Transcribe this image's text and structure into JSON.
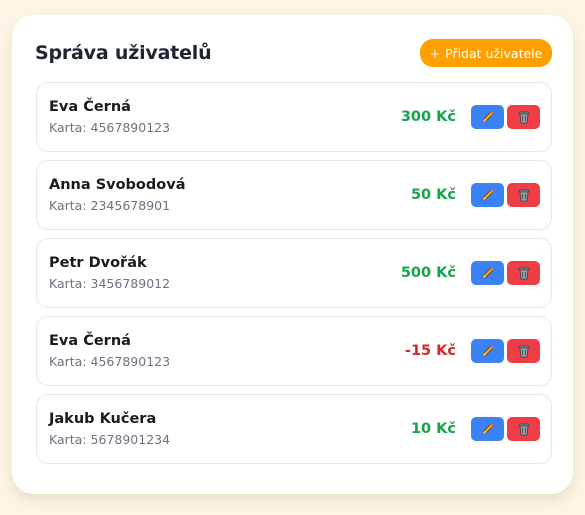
{
  "header": {
    "title": "Správa uživatelů",
    "add_button_icon": "+",
    "add_button_label": "Přidat uživatele"
  },
  "users": [
    {
      "name": "Eva Černá",
      "card": "Karta: 4567890123",
      "balance": "300 Kč",
      "status": "positive"
    },
    {
      "name": "Anna Svobodová",
      "card": "Karta: 2345678901",
      "balance": "50 Kč",
      "status": "positive"
    },
    {
      "name": "Petr Dvořák",
      "card": "Karta: 3456789012",
      "balance": "500 Kč",
      "status": "positive"
    },
    {
      "name": "Eva Černá",
      "card": "Karta: 4567890123",
      "balance": "-15 Kč",
      "status": "negative"
    },
    {
      "name": "Jakub Kučera",
      "card": "Karta: 5678901234",
      "balance": "10 Kč",
      "status": "positive"
    }
  ],
  "icons": {
    "edit": "pencil-icon",
    "delete": "trash-icon"
  },
  "colors": {
    "accent": "#ff9f00",
    "positive": "#16a34a",
    "negative": "#dc2626",
    "edit_button": "#3b82f6",
    "delete_button": "#ef3d46"
  }
}
